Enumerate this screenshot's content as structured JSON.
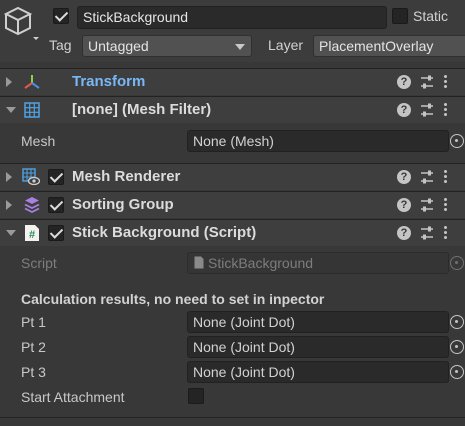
{
  "gameobject": {
    "active": true,
    "name": "StickBackground",
    "static_label": "Static",
    "static_checked": false,
    "tag_label": "Tag",
    "tag_value": "Untagged",
    "layer_label": "Layer",
    "layer_value": "PlacementOverlay"
  },
  "components": {
    "transform": {
      "title": "Transform",
      "expanded": false,
      "title_color": "#7ab8f5",
      "icon": "transform-axes-icon"
    },
    "mesh_filter": {
      "title": "[none] (Mesh Filter)",
      "expanded": true,
      "icon": "mesh-grid-icon",
      "mesh_label": "Mesh",
      "mesh_value": "None (Mesh)"
    },
    "mesh_renderer": {
      "title": "Mesh Renderer",
      "expanded": false,
      "enabled": true,
      "icon": "mesh-renderer-icon"
    },
    "sorting_group": {
      "title": "Sorting Group",
      "expanded": false,
      "enabled": true,
      "icon": "layers-stack-icon"
    },
    "script": {
      "title": "Stick Background (Script)",
      "expanded": true,
      "enabled": true,
      "icon": "csharp-script-icon",
      "script_label": "Script",
      "script_value": "StickBackground",
      "section_header": "Calculation results, no need to set in inpector",
      "fields": [
        {
          "label": "Pt 1",
          "value": "None (Joint Dot)"
        },
        {
          "label": "Pt 2",
          "value": "None (Joint Dot)"
        },
        {
          "label": "Pt 3",
          "value": "None (Joint Dot)"
        }
      ],
      "start_attachment_label": "Start Attachment",
      "start_attachment_checked": false
    }
  },
  "header_icons": {
    "help": "?"
  }
}
